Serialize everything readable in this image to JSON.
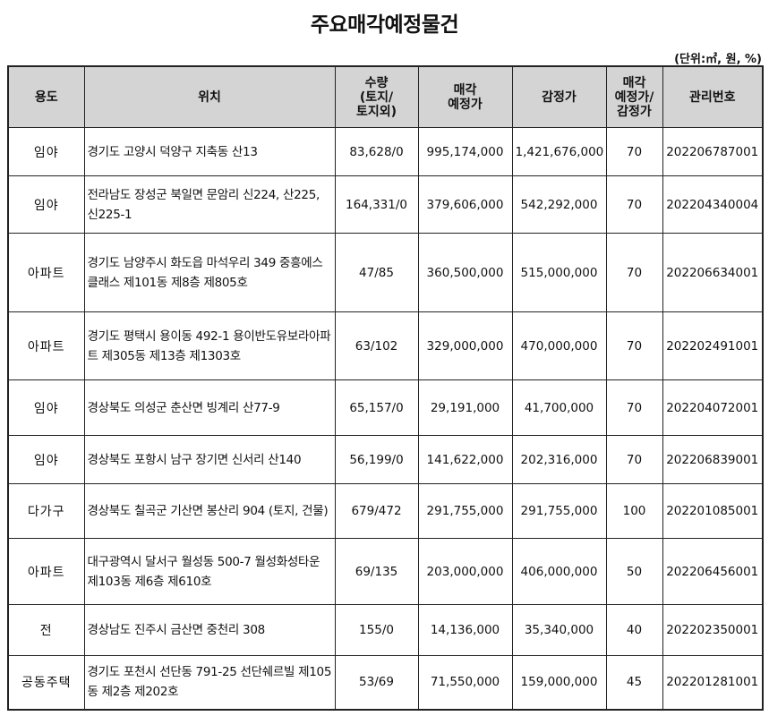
{
  "title": "주요매각예정물건",
  "unit_note": "(단위:㎡, 원, %)",
  "headers": {
    "use": "용도",
    "location": "위치",
    "quantity": "수량\n(토지/\n토지외)",
    "sale_price": "매각\n예정가",
    "appraisal": "감정가",
    "ratio": "매각\n예정가/\n감정가",
    "mgmt_no": "관리번호"
  },
  "rows": [
    {
      "use": "임야",
      "location": "경기도 고양시  덕양구 지축동 산13",
      "quantity": "83,628/0",
      "sale_price": "995,174,000",
      "appraisal": "1,421,676,000",
      "ratio": "70",
      "mgmt_no": "202206787001"
    },
    {
      "use": "임야",
      "location": "전라남도 장성군 북일면 문암리 신224, 산225, 신225-1",
      "quantity": "164,331/0",
      "sale_price": "379,606,000",
      "appraisal": "542,292,000",
      "ratio": "70",
      "mgmt_no": "202204340004"
    },
    {
      "use": "아파트",
      "location": "경기도 남양주시 화도읍 마석우리 349 중흥에스클래스 제101동 제8층 제805호",
      "quantity": "47/85",
      "sale_price": "360,500,000",
      "appraisal": "515,000,000",
      "ratio": "70",
      "mgmt_no": "202206634001"
    },
    {
      "use": "아파트",
      "location": "경기도 평택시 용이동 492-1 용이반도유보라아파트 제305동 제13층 제1303호",
      "quantity": "63/102",
      "sale_price": "329,000,000",
      "appraisal": "470,000,000",
      "ratio": "70",
      "mgmt_no": "202202491001"
    },
    {
      "use": "임야",
      "location": "경상북도 의성군 춘산면 빙계리 산77-9",
      "quantity": "65,157/0",
      "sale_price": "29,191,000",
      "appraisal": "41,700,000",
      "ratio": "70",
      "mgmt_no": "202204072001"
    },
    {
      "use": "임야",
      "location": "경상북도 포항시 남구 장기면 신서리 산140",
      "quantity": "56,199/0",
      "sale_price": "141,622,000",
      "appraisal": "202,316,000",
      "ratio": "70",
      "mgmt_no": "202206839001"
    },
    {
      "use": "다가구",
      "location": "경상북도 칠곡군 기산면 봉산리 904 (토지, 건물)",
      "quantity": "679/472",
      "sale_price": "291,755,000",
      "appraisal": "291,755,000",
      "ratio": "100",
      "mgmt_no": "202201085001"
    },
    {
      "use": "아파트",
      "location": "대구광역시 달서구 월성동 500-7 월성화성타운 제103동 제6층 제610호",
      "quantity": "69/135",
      "sale_price": "203,000,000",
      "appraisal": "406,000,000",
      "ratio": "50",
      "mgmt_no": "202206456001"
    },
    {
      "use": "전",
      "location": "경상남도 진주시 금산면 중천리 308",
      "quantity": "155/0",
      "sale_price": "14,136,000",
      "appraisal": "35,340,000",
      "ratio": "40",
      "mgmt_no": "202202350001"
    },
    {
      "use": "공동주택",
      "location": "경기도 포천시 선단동 791-25 선단쉐르빌 제105동 제2층 제202호",
      "quantity": "53/69",
      "sale_price": "71,550,000",
      "appraisal": "159,000,000",
      "ratio": "45",
      "mgmt_no": "202201281001"
    }
  ]
}
